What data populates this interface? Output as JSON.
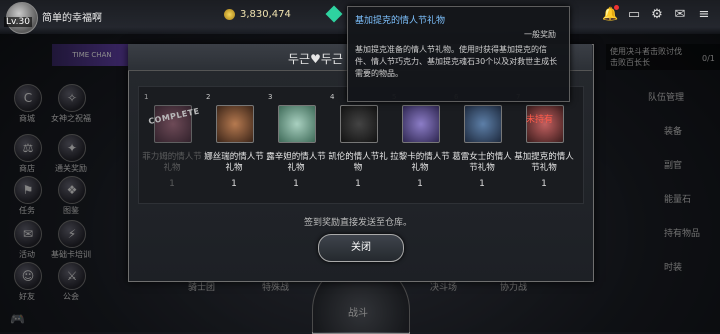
{
  "topbar": {
    "level": "Lv.30",
    "username": "简单的幸福啊",
    "gold": "3,830,474",
    "icons": [
      "bell-icon",
      "chat-icon",
      "gear-icon",
      "mail-icon"
    ]
  },
  "banner": {
    "text": "TIME CHAN"
  },
  "left_menu": [
    {
      "label": "商城",
      "icon": "C"
    },
    {
      "label": "女神之祝福",
      "icon": "✧"
    },
    {
      "label": "商店",
      "icon": "⚖"
    },
    {
      "label": "通关奖励",
      "icon": "✦"
    },
    {
      "label": "任务",
      "icon": "⚑"
    },
    {
      "label": "图鉴",
      "icon": "❖"
    },
    {
      "label": "活动",
      "icon": "✉"
    },
    {
      "label": "基础卡培训",
      "icon": "⚡"
    },
    {
      "label": "好友",
      "icon": "☺"
    },
    {
      "label": "公会",
      "icon": "⚔"
    }
  ],
  "right_menu": [
    "队伍管理",
    "装备",
    "副官",
    "能量石",
    "持有物品",
    "时装"
  ],
  "quest": {
    "line1": "使用决斗者击败讨伐",
    "line2": "击败百长长",
    "count": "0/1"
  },
  "bottom_tabs": [
    "骑士团",
    "特殊战",
    "决斗场",
    "协力战"
  ],
  "battle_label": "战斗",
  "dialog": {
    "title": "두근♥두근",
    "cards": [
      {
        "num": "1",
        "name": "菲力姆的情人节礼物",
        "qty": "1",
        "claimed": true,
        "stamp": "COMPLETE"
      },
      {
        "num": "2",
        "name": "娜丝瑞的情人节礼物",
        "qty": "1"
      },
      {
        "num": "3",
        "name": "露辛妲的情人节礼物",
        "qty": "1"
      },
      {
        "num": "4",
        "name": "凯伦的情人节礼物",
        "qty": "1"
      },
      {
        "num": "5",
        "name": "拉黎卡的情人节礼物",
        "qty": "1"
      },
      {
        "num": "6",
        "name": "葛雷女士的情人节礼物",
        "qty": "1"
      },
      {
        "num": "7",
        "name": "基加提克的情人节礼物",
        "qty": "1",
        "stamp": "未持有"
      }
    ],
    "hint": "签到奖励直接发送至仓库。",
    "close_label": "关闭"
  },
  "tooltip": {
    "title": "基加提克的情人节礼物",
    "type": "一般奖励",
    "desc": "基加提克准备的情人节礼物。使用时获得基加提克的信件、情人节巧克力、基加提克魂石30个以及对救世主成长需要的物品。"
  },
  "colors": {
    "tooltip_title": "#7ec2ff",
    "unowned": "#ff5b4b"
  }
}
